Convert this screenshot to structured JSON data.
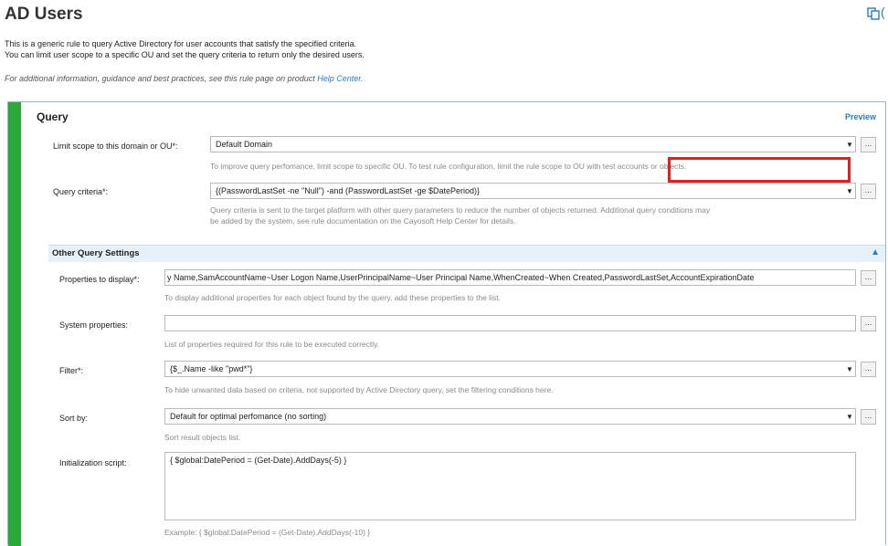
{
  "page": {
    "title": "AD Users",
    "top_right_partial": "(",
    "description_line1": "This is a generic rule to query Active Directory for user accounts that satisfy the specified criteria.",
    "description_line2": "You can limit user scope to a specific OU and set the query criteria to return only the desired users.",
    "help_prefix": "For additional information, guidance and best practices, see this rule page on product ",
    "help_link": "Help Center."
  },
  "query": {
    "title": "Query",
    "preview_label": "Preview",
    "scope": {
      "label": "Limit scope to this domain or OU*:",
      "value": "Default Domain",
      "hint": "To improve query perfomance, limit scope to specific OU. To test rule configuration, limit the rule scope to OU with test accounts or objects."
    },
    "criteria": {
      "label": "Query criteria*:",
      "value": "{(PasswordLastSet -ne \"Null\") -and (PasswordLastSet -ge $DatePeriod)}",
      "hint_line1": "Query criteria is sent to the target platform with other query parameters to reduce the number of objects returned. Additional query conditions may",
      "hint_line2": "be added by the system, see rule documentation on the Cayosoft Help Center for details."
    },
    "other_settings": {
      "title": "Other Query Settings",
      "properties": {
        "label": "Properties to display*:",
        "value": "y Name,SamAccountName~User Logon Name,UserPrincipalName~User Principal Name,WhenCreated~When Created,PasswordLastSet,AccountExpirationDate",
        "hint": "To display additional properties for each object found by the query, add these properties to the list."
      },
      "system_properties": {
        "label": "System properties:",
        "value": "",
        "hint": "List of properties required for this rule to be executed correctly."
      },
      "filter": {
        "label": "Filter*:",
        "value": "{$_.Name -like \"pwd*\"}",
        "hint": "To hide unwanted data based on criteria, not supported by Active Directory query, set the filtering conditions here."
      },
      "sort": {
        "label": "Sort by:",
        "value": "Default for optimal perfomance (no sorting)",
        "hint": "Sort result objects list."
      },
      "init_script": {
        "label": "Initialization script:",
        "value": "{ $global:DatePeriod = (Get-Date).AddDays(-5) }",
        "hint": "Example: { $global:DatePeriod = (Get-Date).AddDays(-10) }"
      }
    }
  },
  "buttons": {
    "ellipsis": "..."
  },
  "icons": {
    "dropdown": "▼",
    "collapse": "▲",
    "copy": "copy-icon"
  },
  "colors": {
    "accent": "#2b7bbf",
    "green_bar": "#2aa83a",
    "highlight": "#e02020"
  }
}
